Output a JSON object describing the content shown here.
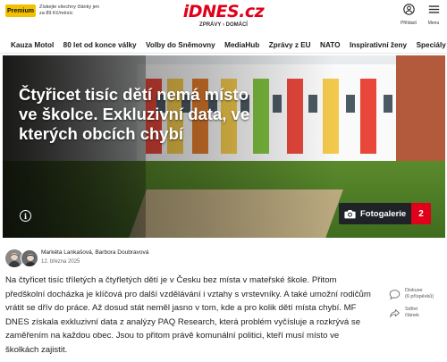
{
  "header": {
    "premium_label": "Premium",
    "premium_promo": "Získejte všechny články jen za 89 Kč/měsíc",
    "logo_text": "iDNES",
    "logo_tld": ".cz",
    "sub_left": "ZPRÁVY",
    "sub_sep": "›",
    "sub_right": "DOMÁCÍ",
    "login_label": "Přihlásit",
    "menu_label": "Menu"
  },
  "nav": {
    "items": [
      "Kauza Motol",
      "80 let od konce války",
      "Volby do Sněmovny",
      "MediaHub",
      "Zprávy z EU",
      "NATO",
      "Inspirativní ženy",
      "Speciály"
    ]
  },
  "hero": {
    "title": "Čtyřicet tisíc dětí nemá místo ve školce. Exkluzivní data, ve kterých obcích chybí",
    "info_icon": "info-icon",
    "gallery_label": "Fotogalerie",
    "gallery_count": "2"
  },
  "article": {
    "authors": "Markéta Lankašová, Barbora Doubravová",
    "date": "12. března 2025",
    "lead": "Na čtyřicet tisíc tříletých a čtyřletých dětí je v Česku bez místa v mateřské škole. Přitom předškolní docházka je klíčová pro další vzdělávání i vztahy s vrstevníky. A také umožní rodičům vrátit se dřív do práce. Až dosud stát neměl jasno v tom, kde a pro kolik dětí místa chybí. MF DNES získala exkluzivní data z analýzy PAQ Research, která problém vyčísluje a rozkrývá se zaměřením na každou obec. Jsou to přitom právě komunální politici, kteří musí místo ve školkách zajistit."
  },
  "side": {
    "discussion_label": "Diskuse",
    "discussion_count": "(6 příspěvků)",
    "share_label": "Sdílet",
    "share_sub": "článek"
  },
  "colors": {
    "brand_red": "#e0001a",
    "premium_yellow": "#f2c200",
    "gallery_bg": "#1f2226"
  }
}
